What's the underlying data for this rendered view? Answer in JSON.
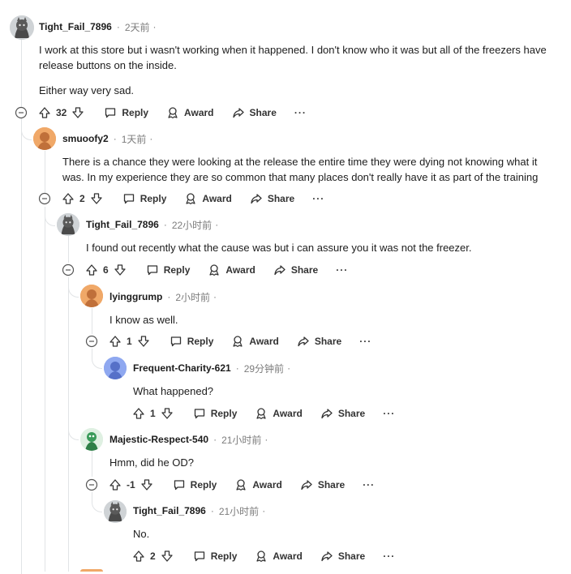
{
  "actions": {
    "reply": "Reply",
    "award": "Award",
    "share": "Share",
    "more": "···"
  },
  "comments": [
    {
      "author": "Tight_Fail_7896",
      "time": "2天前",
      "trail": "·",
      "body_lines": [
        "I work at this store but i wasn't working when it happened. I don't know who it was but all of the freezers have",
        "release buttons on the inside."
      ],
      "body_p2": "Either way very sad.",
      "votes": "32"
    },
    {
      "author": "smuoofy2",
      "time": "1天前",
      "trail": "·",
      "body_lines": [
        "There is a chance they were looking at the release the entire time they were dying not knowing what it",
        "was. In my experience they are so common that many places don't really have it as part of the training"
      ],
      "votes": "2"
    },
    {
      "author": "Tight_Fail_7896",
      "time": "22小时前",
      "trail": "·",
      "body": "I found out recently what the cause was but i can assure you it was not the freezer.",
      "votes": "6"
    },
    {
      "author": "lyinggrump",
      "time": "2小时前",
      "trail": "·",
      "body": "I know as well.",
      "votes": "1"
    },
    {
      "author": "Frequent-Charity-621",
      "time": "29分钟前",
      "trail": "·",
      "body": "What happened?",
      "votes": "1"
    },
    {
      "author": "Majestic-Respect-540",
      "time": "21小时前",
      "trail": "·",
      "body": "Hmm, did he OD?",
      "votes": "-1"
    },
    {
      "author": "Tight_Fail_7896",
      "time": "21小时前",
      "trail": "·",
      "body": "No.",
      "votes": "2"
    }
  ],
  "colors": {
    "orange_avatar": "#f0a868",
    "blue_avatar": "#8fa8f0",
    "green_avatar": "#3a9b5a",
    "line": "#e1e4e6"
  },
  "icons": [
    "upvote-icon",
    "downvote-icon",
    "reply-icon",
    "award-icon",
    "share-icon",
    "collapse-icon",
    "more-icon"
  ]
}
